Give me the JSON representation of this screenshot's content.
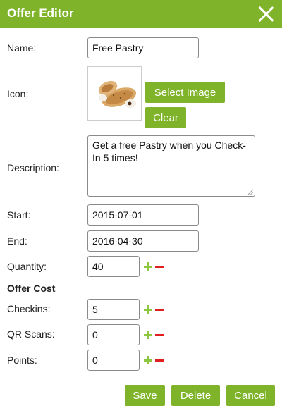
{
  "dialog": {
    "title": "Offer Editor",
    "close_icon": "close-icon"
  },
  "form": {
    "name": {
      "label": "Name:",
      "value": "Free Pastry"
    },
    "icon": {
      "label": "Icon:",
      "select_label": "Select Image",
      "clear_label": "Clear",
      "image": "pastry-image"
    },
    "description": {
      "label": "Description:",
      "value": "Get a free Pastry when you Check-In 5 times!"
    },
    "start": {
      "label": "Start:",
      "value": "2015-07-01"
    },
    "end": {
      "label": "End:",
      "value": "2016-04-30"
    },
    "quantity": {
      "label": "Quantity:",
      "value": "40"
    },
    "offer_cost_heading": "Offer Cost",
    "checkins": {
      "label": "Checkins:",
      "value": "5"
    },
    "qr_scans": {
      "label": "QR Scans:",
      "value": "0"
    },
    "points": {
      "label": "Points:",
      "value": "0"
    }
  },
  "footer": {
    "save_label": "Save",
    "delete_label": "Delete",
    "cancel_label": "Cancel"
  },
  "colors": {
    "accent": "#7fb42a",
    "plus": "#8dc63f",
    "minus": "#e02020"
  }
}
